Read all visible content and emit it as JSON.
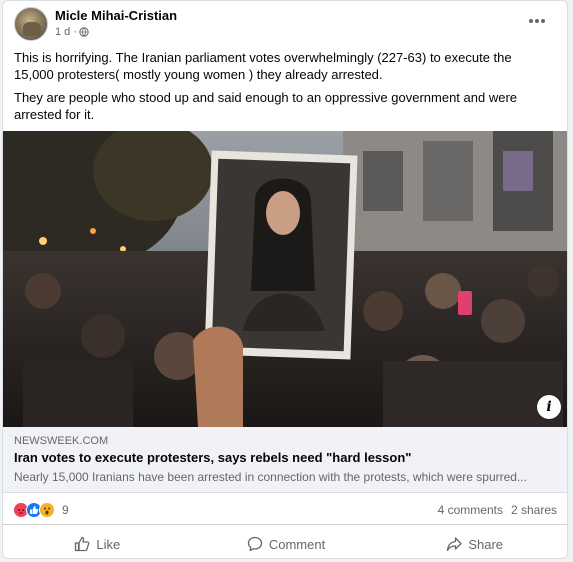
{
  "post": {
    "author": "Micle Mihai-Cristian",
    "time": "1 d ·",
    "paragraphs": [
      "This is horrifying. The Iranian parliament votes overwhelmingly (227-63) to execute the 15,000 protesters( mostly young women ) they already arrested.",
      "They are people who stood up and said enough to an oppressive government and were arrested for it."
    ],
    "more_icon": "more-options-icon"
  },
  "photo": {
    "info_label": "i"
  },
  "link": {
    "domain": "NEWSWEEK.COM",
    "title": "Iran votes to execute protesters, says rebels need \"hard lesson\"",
    "description": "Nearly 15,000 Iranians have been arrested in connection with the protests, which were spurred..."
  },
  "stats": {
    "reaction_count": "9",
    "reactions": [
      "angry",
      "like",
      "wow"
    ],
    "comments": "4 comments",
    "shares": "2 shares"
  },
  "actions": {
    "like": "Like",
    "comment": "Comment",
    "share": "Share"
  }
}
